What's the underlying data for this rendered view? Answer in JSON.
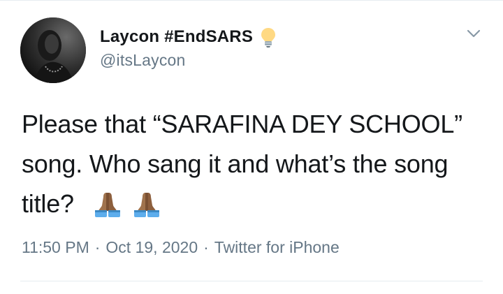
{
  "tweet": {
    "author": {
      "display_name": "Laycon #EndSARS",
      "name_emoji": "light-bulb-icon",
      "handle": "@itsLaycon"
    },
    "text": "Please that “SARAFINA DEY SCHOOL” song. Who sang it and what’s the song title?",
    "emojis": [
      "folded-hands-icon",
      "folded-hands-icon"
    ],
    "time": "11:50 PM",
    "date": "Oct 19, 2020",
    "separator": "·",
    "source": "Twitter for iPhone"
  },
  "colors": {
    "text": "#14171a",
    "secondary": "#657786",
    "divider": "#e6ecf0"
  }
}
